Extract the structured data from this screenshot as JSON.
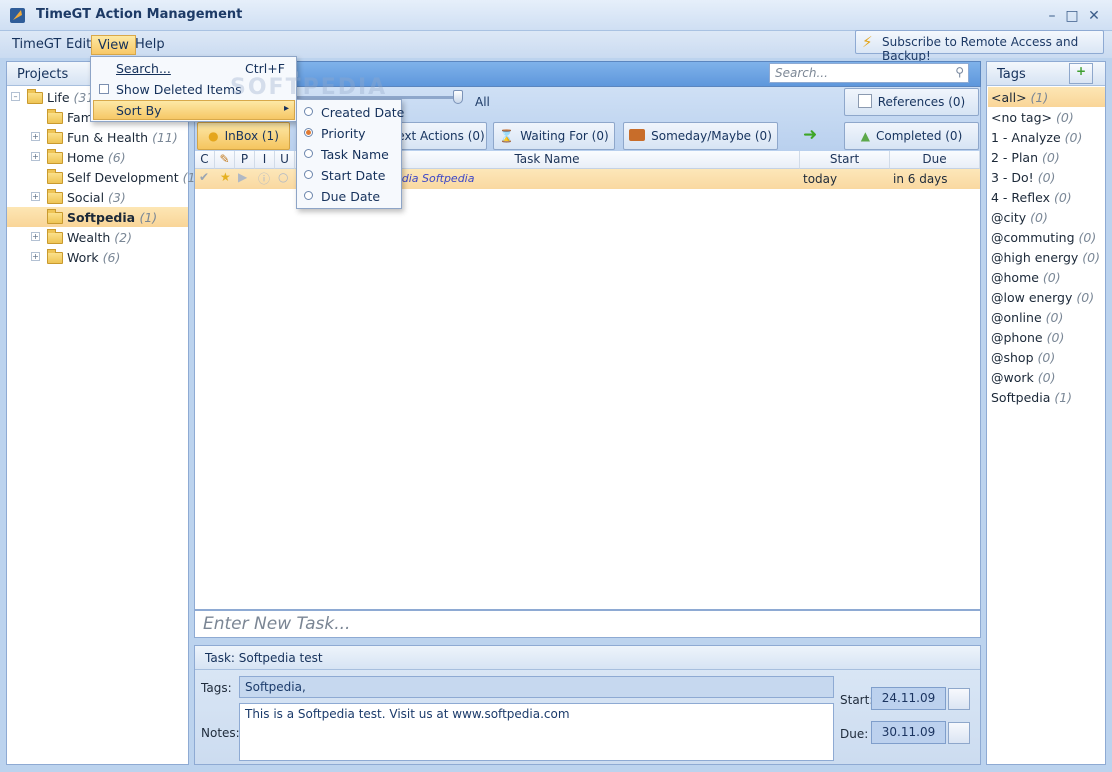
{
  "window": {
    "title": "TimeGT Action Management"
  },
  "menubar": {
    "items": [
      "TimeGT",
      "Edit",
      "View",
      "Help"
    ]
  },
  "subscribe": {
    "label": "Subscribe to Remote Access and Backup!"
  },
  "projects": {
    "header": "Projects",
    "items": [
      {
        "label": "Life",
        "count": "(31)"
      },
      {
        "label": "Fam",
        "count": ""
      },
      {
        "label": "Fun & Health",
        "count": "(11)"
      },
      {
        "label": "Home",
        "count": "(6)"
      },
      {
        "label": "Self Development",
        "count": "(1)"
      },
      {
        "label": "Social",
        "count": "(3)"
      },
      {
        "label": "Softpedia",
        "count": "(1)"
      },
      {
        "label": "Wealth",
        "count": "(2)"
      },
      {
        "label": "Work",
        "count": "(6)"
      }
    ]
  },
  "center": {
    "title_fragment": "ia",
    "search_placeholder": "Search...",
    "slider_label": "All",
    "buttons": {
      "references": "References (0)",
      "inbox": "InBox (1)",
      "next_actions": "ext Actions (0)",
      "waiting": "Waiting For (0)",
      "someday": "Someday/Maybe (0)",
      "completed": "Completed (0)"
    },
    "columns": {
      "c": "C",
      "p": "P",
      "i": "I",
      "u": "U",
      "name": "Task Name",
      "start": "Start",
      "due": "Due"
    },
    "task": {
      "name": "edia Softpedia",
      "start": "today",
      "due": "in 6 days"
    },
    "new_task_placeholder": "Enter New Task..."
  },
  "detail": {
    "title": "Task: Softpedia test",
    "tags_label": "Tags:",
    "tags_value": "Softpedia,",
    "notes_label": "Notes:",
    "notes_value": "This is a Softpedia test. Visit us at www.softpedia.com",
    "start_label": "Start:",
    "start_value": "24.11.09",
    "due_label": "Due:",
    "due_value": "30.11.09"
  },
  "tags": {
    "header": "Tags",
    "items": [
      {
        "label": "<all>",
        "count": "(1)"
      },
      {
        "label": "<no tag>",
        "count": "(0)"
      },
      {
        "label": "1 - Analyze",
        "count": "(0)"
      },
      {
        "label": "2 - Plan",
        "count": "(0)"
      },
      {
        "label": "3 - Do!",
        "count": "(0)"
      },
      {
        "label": "4 - Reflex",
        "count": "(0)"
      },
      {
        "label": "@city",
        "count": "(0)"
      },
      {
        "label": "@commuting",
        "count": "(0)"
      },
      {
        "label": "@high energy",
        "count": "(0)"
      },
      {
        "label": "@home",
        "count": "(0)"
      },
      {
        "label": "@low energy",
        "count": "(0)"
      },
      {
        "label": "@online",
        "count": "(0)"
      },
      {
        "label": "@phone",
        "count": "(0)"
      },
      {
        "label": "@shop",
        "count": "(0)"
      },
      {
        "label": "@work",
        "count": "(0)"
      },
      {
        "label": "Softpedia",
        "count": "(1)"
      }
    ]
  },
  "view_menu": {
    "search": "Search...",
    "search_shortcut": "Ctrl+F",
    "show_deleted": "Show Deleted Items",
    "sort_by": "Sort By"
  },
  "sort_menu": {
    "items": [
      "Created Date",
      "Priority",
      "Task Name",
      "Start Date",
      "Due Date"
    ],
    "selected": "Priority"
  },
  "watermark": "SOFTPEDIA",
  "colors": {
    "accent": "#f9c96a",
    "header_blue": "#6aa3e3",
    "panel_border": "#8eaad3"
  }
}
